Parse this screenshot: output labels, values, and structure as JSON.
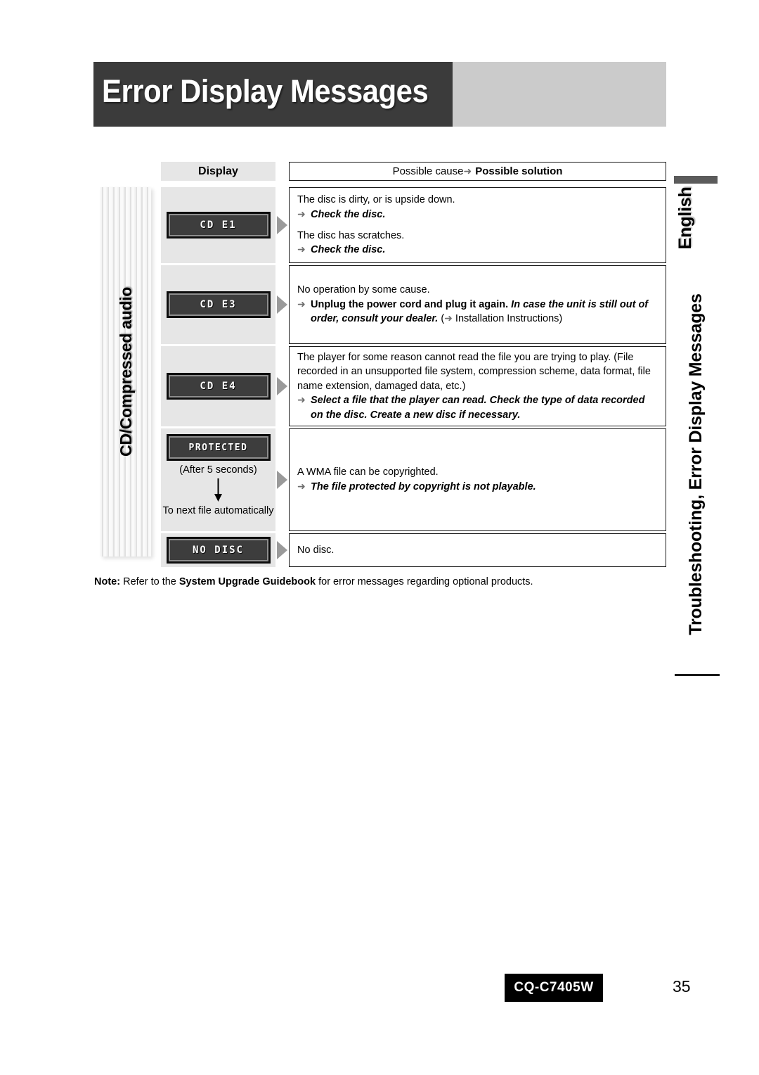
{
  "page": {
    "title": "Error Display Messages",
    "model": "CQ-C7405W",
    "page_number": "35"
  },
  "rail": {
    "language": "English",
    "section": "Troubleshooting, Error Display Messages"
  },
  "left_ribbon": {
    "label": "CD/Compressed audio"
  },
  "table": {
    "header": {
      "display": "Display",
      "cause_prefix": "Possible cause ",
      "cause_arrow": "➜",
      "solution_label": "Possible solution"
    },
    "rows": [
      {
        "display_text": "CD  E1",
        "entries": [
          {
            "cause": "The disc is dirty, or is upside down.",
            "arrow": "➜",
            "solution": "Check the disc.",
            "solution_style": "bold-italic"
          },
          {
            "cause": "The disc has scratches.",
            "arrow": "➜",
            "solution": "Check the disc.",
            "solution_style": "bold-italic"
          }
        ]
      },
      {
        "display_text": "CD  E3",
        "entries": [
          {
            "cause": "No operation by some cause.",
            "arrow": "➜",
            "solution_bold": "Unplug the power cord and plug it again. ",
            "solution_italic": "In case the unit is still out of order, consult your dealer.",
            "solution_tail_open": " (",
            "solution_tail_arrow": "➜",
            "solution_tail_text": " Installation Instructions)"
          }
        ]
      },
      {
        "display_text": "CD  E4",
        "entries": [
          {
            "cause": "The player for some reason cannot read the file you are trying to play. (File recorded in an unsupported file system, compression scheme, data format, file name extension, damaged data, etc.)",
            "arrow": "➜",
            "solution": "Select a file that the player can read. Check the type of data recorded on the disc. Create a new disc if necessary.",
            "solution_style": "bold-italic"
          }
        ]
      },
      {
        "display_text": "PROTECTED",
        "after_note": "(After 5 seconds)",
        "next_note": "To next file automatically",
        "entries": [
          {
            "cause": "A WMA file can be copyrighted.",
            "arrow": "➜",
            "solution": "The file protected by copyright is not playable.",
            "solution_style": "bold-italic"
          }
        ]
      },
      {
        "display_text": "NO DISC",
        "entries": [
          {
            "cause": "No disc."
          }
        ]
      }
    ]
  },
  "note": {
    "label": "Note:",
    "text_before": " Refer to the ",
    "bold_title": "System Upgrade Guidebook",
    "text_after": " for error messages regarding optional products."
  }
}
